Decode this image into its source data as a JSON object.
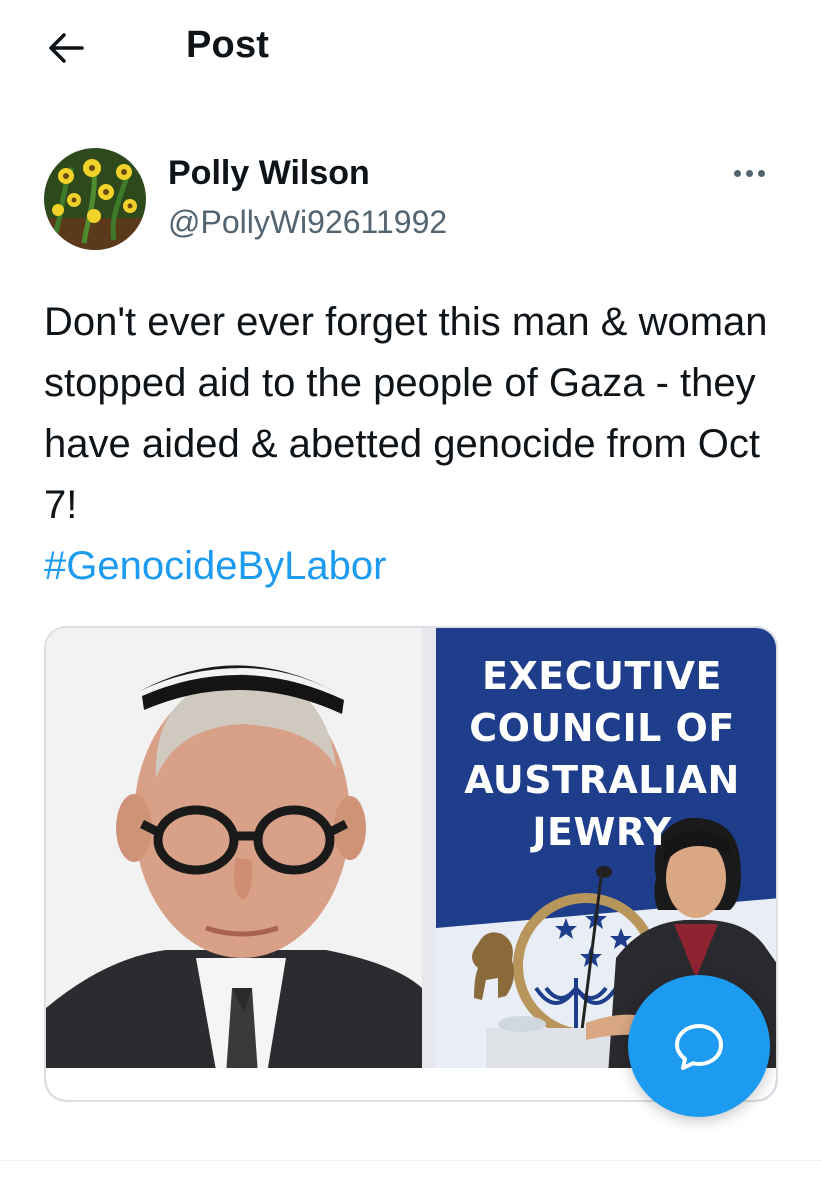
{
  "header": {
    "title": "Post",
    "back_icon": "arrow-left-icon"
  },
  "author": {
    "display_name": "Polly Wilson",
    "handle": "@PollyWi92611992",
    "more_icon": "more-horizontal-icon"
  },
  "tweet": {
    "text": "Don't ever ever forget this man & woman stopped aid to the people of Gaza - they have aided & abetted genocide from Oct 7!",
    "hashtag": "#GenocideByLabor"
  },
  "media": {
    "banner_lines": [
      "EXECUTIVE",
      "COUNCIL OF",
      "AUSTRALIAN",
      "JEWRY"
    ]
  },
  "fab": {
    "icon": "reply-bubble-icon"
  },
  "colors": {
    "accent": "#1d9bf0",
    "text": "#0f1419",
    "secondary": "#536471",
    "banner_blue": "#1e3e8c"
  }
}
